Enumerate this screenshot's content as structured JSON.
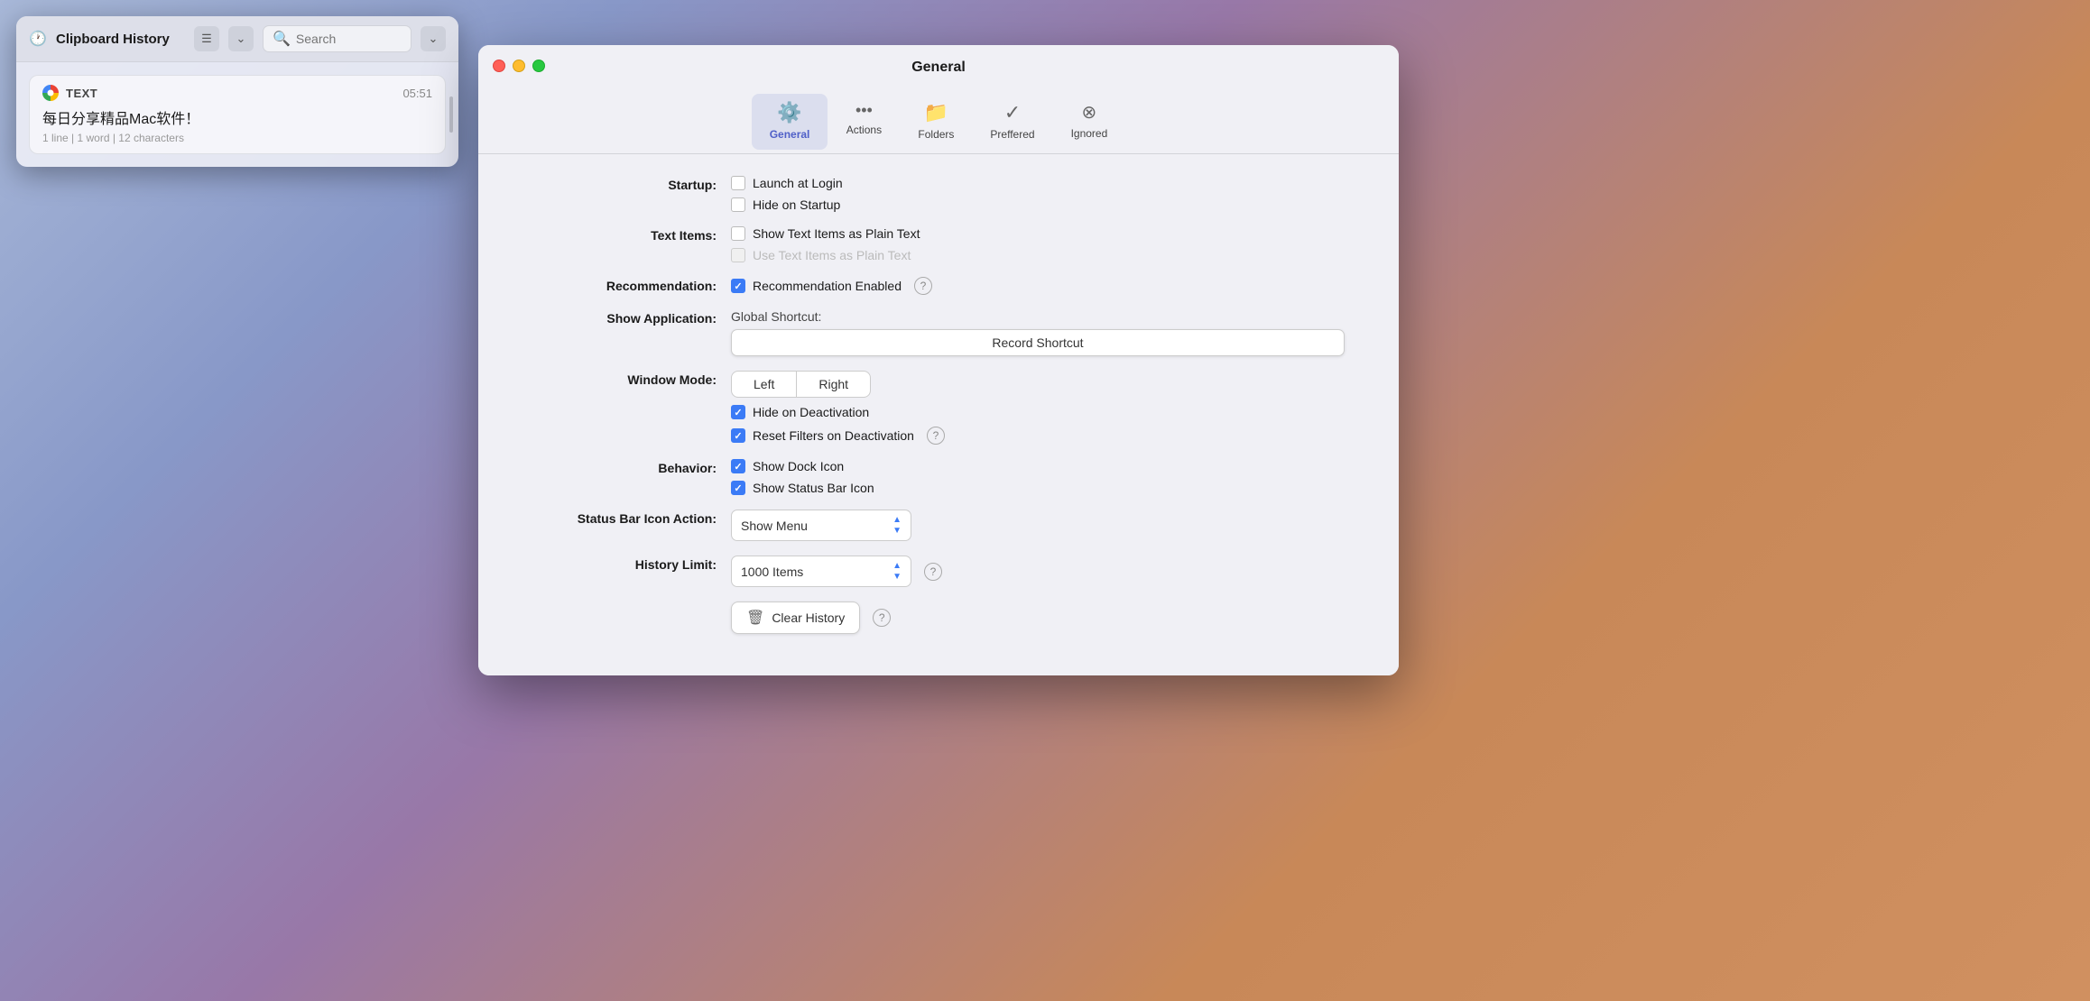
{
  "clipboard_panel": {
    "title": "Clipboard History",
    "search_placeholder": "Search",
    "item": {
      "type_label": "TEXT",
      "time": "05:51",
      "content": "每日分享精品Mac软件！",
      "meta": "1 line | 1 word | 12 characters"
    }
  },
  "settings_window": {
    "title": "General",
    "tabs": [
      {
        "id": "general",
        "label": "General",
        "icon": "⚙️",
        "active": true
      },
      {
        "id": "actions",
        "label": "Actions",
        "icon": "···",
        "active": false
      },
      {
        "id": "folders",
        "label": "Folders",
        "icon": "📁",
        "active": false
      },
      {
        "id": "preffered",
        "label": "Preffered",
        "icon": "✓",
        "active": false
      },
      {
        "id": "ignored",
        "label": "Ignored",
        "icon": "⊗",
        "active": false
      }
    ],
    "rows": {
      "startup_label": "Startup:",
      "launch_at_login": "Launch at Login",
      "hide_on_startup": "Hide on Startup",
      "text_items_label": "Text Items:",
      "show_text_plain": "Show Text Items as Plain Text",
      "use_text_plain": "Use Text Items as Plain Text",
      "recommendation_label": "Recommendation:",
      "recommendation_enabled": "Recommendation Enabled",
      "global_shortcut": "Global Shortcut:",
      "show_application_label": "Show Application:",
      "record_shortcut": "Record Shortcut",
      "window_mode_label": "Window Mode:",
      "window_left": "Left",
      "window_right": "Right",
      "hide_on_deactivation": "Hide on Deactivation",
      "reset_filters": "Reset Filters on Deactivation",
      "behavior_label": "Behavior:",
      "show_dock_icon": "Show Dock Icon",
      "show_status_bar_icon": "Show Status Bar Icon",
      "status_bar_label": "Status Bar Icon Action:",
      "show_menu": "Show Menu",
      "history_limit_label": "History Limit:",
      "history_limit_value": "1000 Items",
      "clear_history": "Clear History"
    }
  }
}
